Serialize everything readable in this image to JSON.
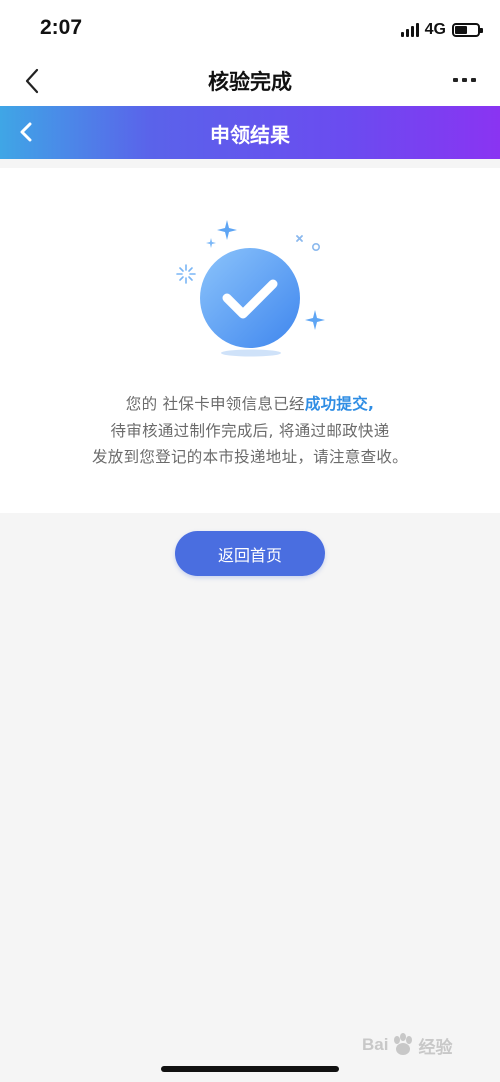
{
  "status_bar": {
    "time": "2:07",
    "network": "4G",
    "icons": [
      "signal-icon",
      "battery-icon"
    ]
  },
  "nav": {
    "title": "核验完成",
    "back_icon": "chevron-left-icon",
    "more_icon": "more-dots-icon"
  },
  "banner": {
    "title": "申领结果",
    "back_icon": "chevron-left-icon",
    "gradient": [
      "#3fa6e6",
      "#5a63ea",
      "#8a34f2"
    ]
  },
  "result": {
    "icon": "success-check-icon",
    "line1_prefix": "您的 社保卡申领信息已经",
    "line1_highlight": "成功提交,",
    "line2": "待审核通过制作完成后, 将通过邮政快递",
    "line3": "发放到您登记的本市投递地址，请注意查收。"
  },
  "actions": {
    "home_button_label": "返回首页"
  },
  "watermark": {
    "text_a": "Bai",
    "text_b": "经验",
    "icon": "paw-logo-icon"
  },
  "colors": {
    "accent": "#4a6ee0",
    "highlight": "#2f8de4",
    "page_bg": "#f5f5f5"
  }
}
